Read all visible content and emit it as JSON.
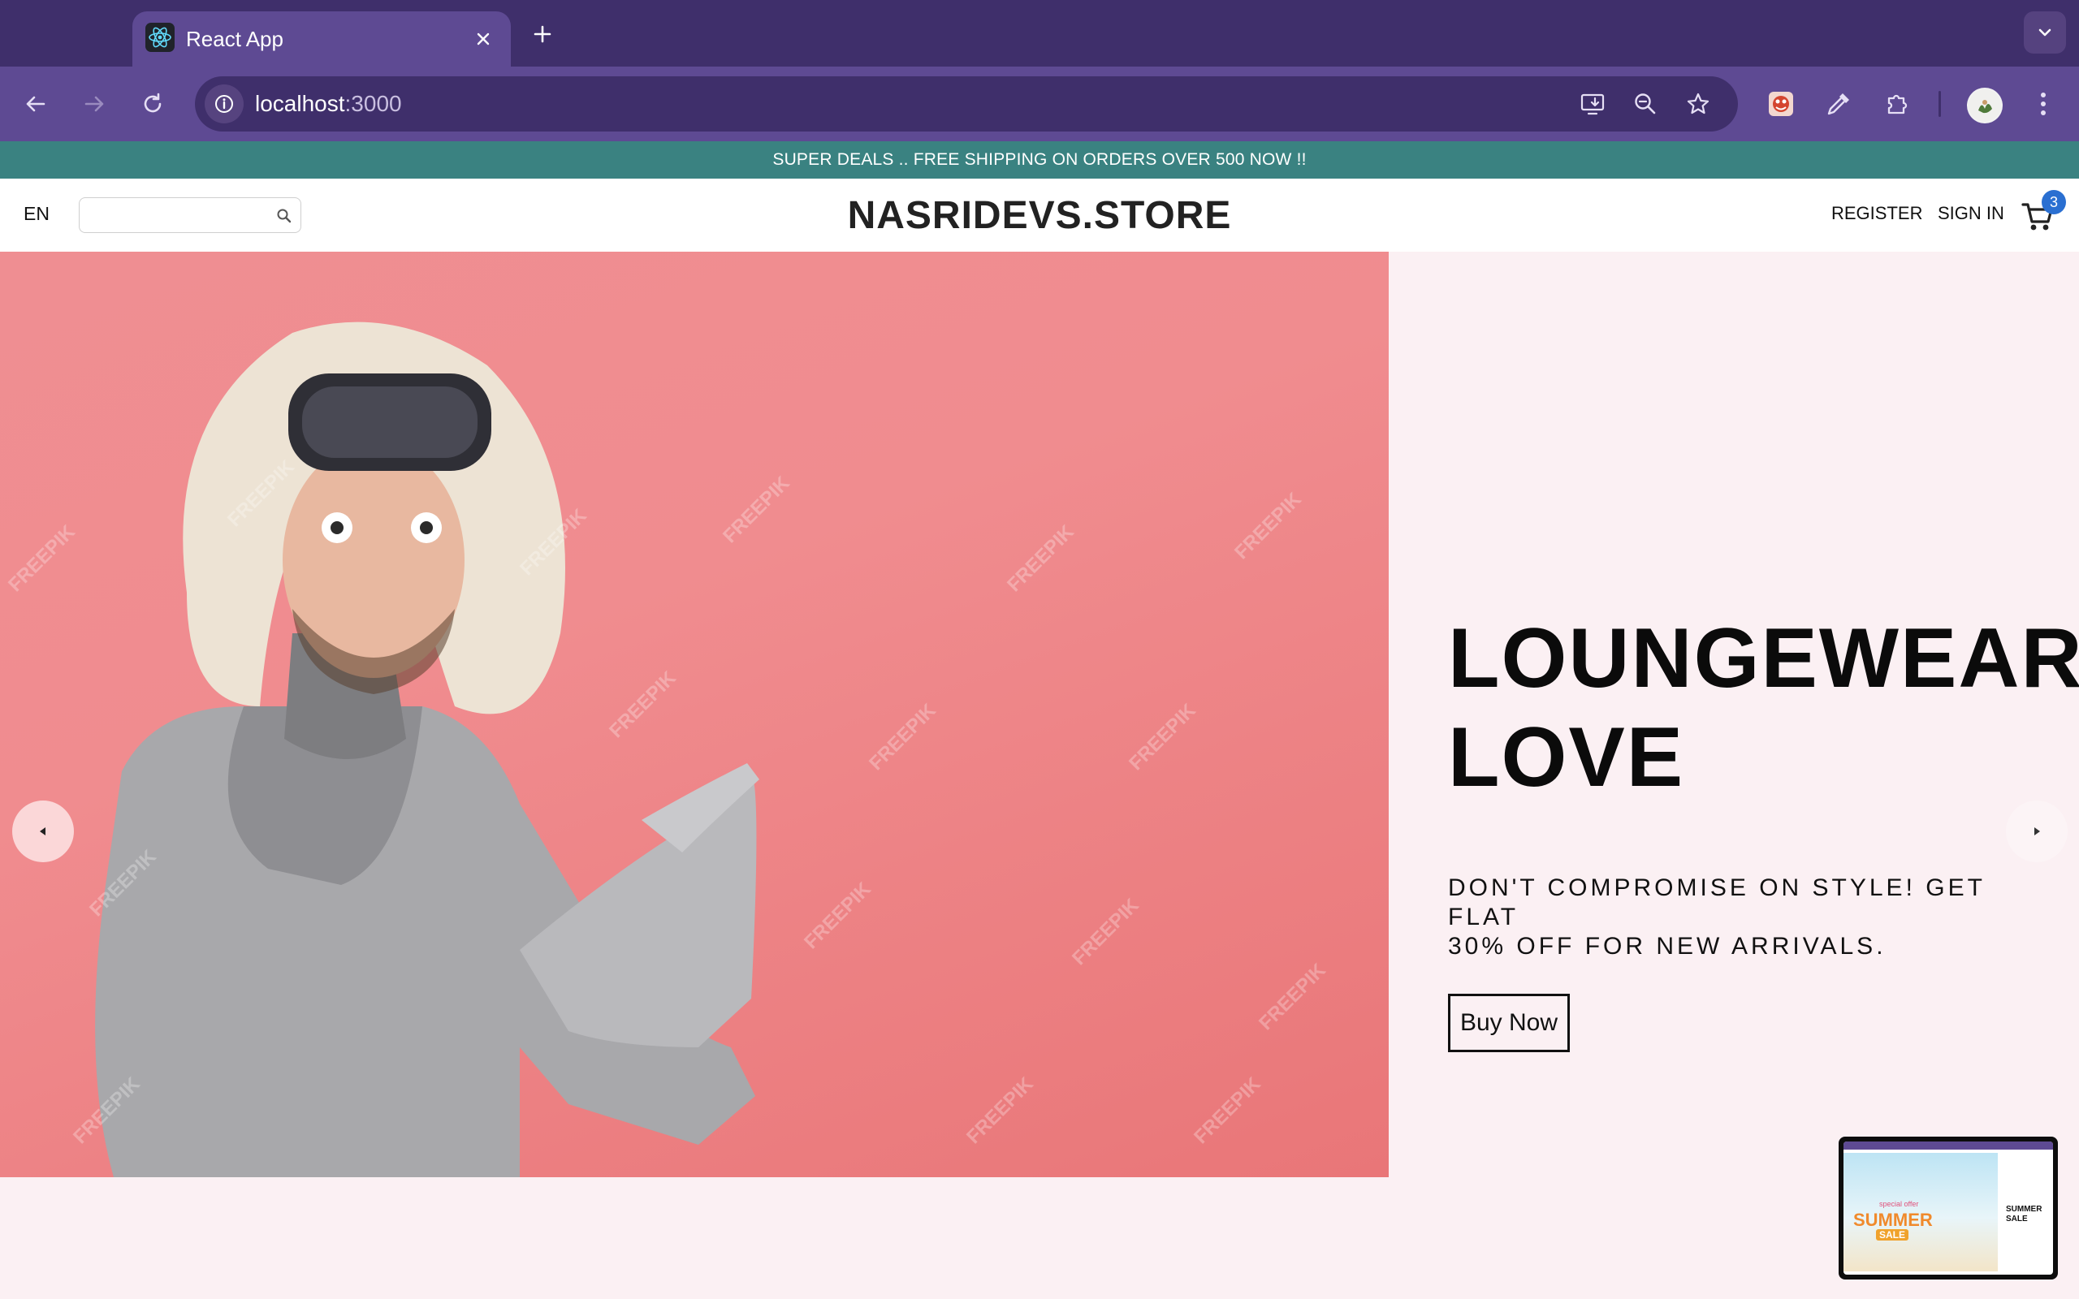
{
  "browser": {
    "tab_title": "React App",
    "url_host": "localhost",
    "url_port": ":3000"
  },
  "announcement": "SUPER DEALS .. FREE SHIPPING ON ORDERS OVER 500 NOW !!",
  "nav": {
    "language": "EN",
    "search_placeholder": "",
    "logo": "NASRIDEVS.STORE",
    "register": "REGISTER",
    "signin": "SIGN IN",
    "cart_count": "3"
  },
  "hero": {
    "title_line1": "LOUNGEWEAR",
    "title_line2": "LOVE",
    "description_line1": "DON'T COMPROMISE ON STYLE! GET FLAT",
    "description_line2": "30% OFF FOR NEW ARRIVALS.",
    "button": "Buy Now"
  },
  "thumbnail": {
    "sale_small": "special offer",
    "sale_main": "SUMMER",
    "sale_tag": "SALE",
    "side_text": "SUMMER SALE"
  },
  "colors": {
    "tabbar": "#3f2f6b",
    "toolbar": "#5e4a93",
    "announcement_bg": "#3a8281",
    "hero_image_bg": "#ef8e92",
    "hero_bg": "#fbf0f3",
    "cart_badge": "#2a6fd1"
  },
  "icons": [
    "react-icon",
    "close-icon",
    "plus-icon",
    "chevron-down-icon",
    "back-icon",
    "forward-icon",
    "reload-icon",
    "info-icon",
    "install-icon",
    "zoom-icon",
    "star-icon",
    "extension-icon",
    "eyedropper-icon",
    "puzzle-icon",
    "more-icon",
    "search-icon",
    "cart-icon",
    "arrow-left-icon",
    "arrow-right-icon"
  ]
}
